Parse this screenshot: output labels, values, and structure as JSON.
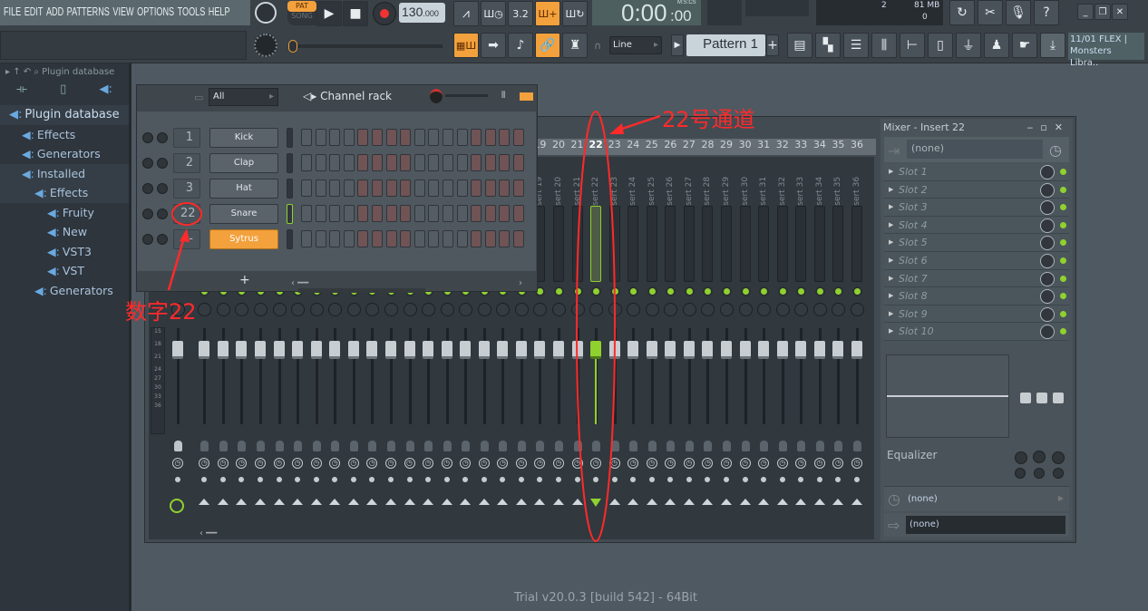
{
  "menu": [
    "FILE",
    "EDIT",
    "ADD",
    "PATTERNS",
    "VIEW",
    "OPTIONS",
    "TOOLS",
    "HELP"
  ],
  "transport": {
    "pat": "PAT",
    "song": "SONG",
    "tempo": "130",
    "tempo_frac": ".000",
    "time": "0:00",
    "time_cs": ":00",
    "time_label": "M:S:CS"
  },
  "cpu": {
    "voices": "2",
    "memory": "81 MB",
    "polyphony": "0"
  },
  "snap": "Line",
  "pattern": "Pattern 1",
  "hint": {
    "line1": "11/01  FLEX |",
    "line2": "Monsters Libra.."
  },
  "browser": {
    "title": "Plugin database",
    "items": [
      {
        "label": "Plugin database",
        "level": 0
      },
      {
        "label": "Effects",
        "level": 1
      },
      {
        "label": "Generators",
        "level": 1
      },
      {
        "label": "Installed",
        "level": 1
      },
      {
        "label": "Effects",
        "level": 2
      },
      {
        "label": "Fruity",
        "level": 3
      },
      {
        "label": "New",
        "level": 3
      },
      {
        "label": "VST3",
        "level": 3
      },
      {
        "label": "VST",
        "level": 3
      },
      {
        "label": "Generators",
        "level": 2
      }
    ]
  },
  "channel_rack": {
    "filter": "All",
    "title": "Channel rack",
    "add": "+",
    "channels": [
      {
        "route": "1",
        "name": "Kick"
      },
      {
        "route": "2",
        "name": "Clap"
      },
      {
        "route": "3",
        "name": "Hat"
      },
      {
        "route": "22",
        "name": "Snare"
      },
      {
        "route": "-",
        "name": "Sytrus",
        "selected": true
      }
    ]
  },
  "mixer": {
    "selected": 22,
    "channel_count": 36,
    "insert_prefix": "Insert",
    "meter_scale": [
      "15",
      "18",
      "21",
      "24",
      "27",
      "30",
      "33",
      "36"
    ]
  },
  "insert_panel": {
    "title": "Mixer - Insert 22",
    "input": "(none)",
    "slots": [
      "Slot 1",
      "Slot 2",
      "Slot 3",
      "Slot 4",
      "Slot 5",
      "Slot 6",
      "Slot 7",
      "Slot 8",
      "Slot 9",
      "Slot 10"
    ],
    "eq_label": "Equalizer",
    "time": "(none)",
    "output": "(none)"
  },
  "annotations": {
    "channel": "22号通道",
    "number": "数字22"
  },
  "footer": "Trial v20.0.3 [build 542] - 64Bit",
  "colors": {
    "accent": "#f3a13c",
    "selected": "#8fd12f",
    "annotation": "#ff2a2a"
  }
}
